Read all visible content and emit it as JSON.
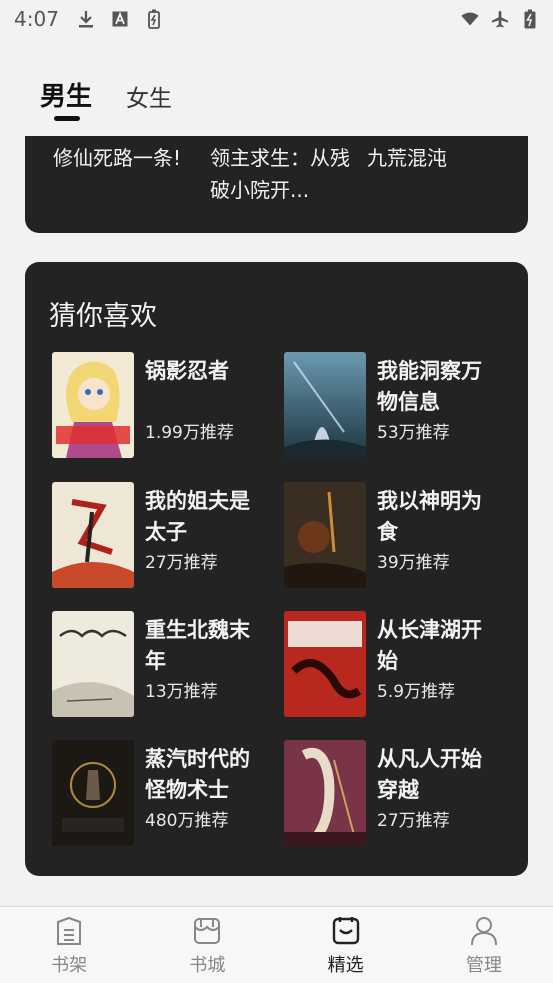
{
  "status_bar": {
    "time": "4:07",
    "icons_left": [
      "download-icon",
      "a-box-icon",
      "battery-saver-icon"
    ],
    "icons_right": [
      "wifi-icon",
      "airplane-icon",
      "battery-charging-icon"
    ]
  },
  "tabs": [
    {
      "label": "男生",
      "active": true
    },
    {
      "label": "女生",
      "active": false
    }
  ],
  "top_books": [
    {
      "title": "修仙死路一条!"
    },
    {
      "title": "领主求生：从残破小院开..."
    },
    {
      "title": "九荒混沌"
    }
  ],
  "guess": {
    "title": "猜你喜欢",
    "books": [
      {
        "title": "锅影忍者",
        "count": "1.99万推荐",
        "cover_color": "#d9c6a0"
      },
      {
        "title": "我能洞察万物信息",
        "count": "53万推荐",
        "cover_color": "#3a5a6a"
      },
      {
        "title": "我的姐夫是太子",
        "count": "27万推荐",
        "cover_color": "#e8e0d0"
      },
      {
        "title": "我以神明为食",
        "count": "39万推荐",
        "cover_color": "#4a3a2a"
      },
      {
        "title": "重生北魏末年",
        "count": "13万推荐",
        "cover_color": "#ece8dc"
      },
      {
        "title": "从长津湖开始",
        "count": "5.9万推荐",
        "cover_color": "#b8281f"
      },
      {
        "title": "蒸汽时代的怪物术士",
        "count": "480万推荐",
        "cover_color": "#2a2420"
      },
      {
        "title": "从凡人开始穿越",
        "count": "27万推荐",
        "cover_color": "#6a3040"
      }
    ]
  },
  "bottom_nav": [
    {
      "label": "书架",
      "icon": "bookshelf-icon",
      "active": false
    },
    {
      "label": "书城",
      "icon": "store-icon",
      "active": false
    },
    {
      "label": "精选",
      "icon": "featured-icon",
      "active": true
    },
    {
      "label": "管理",
      "icon": "user-icon",
      "active": false
    }
  ]
}
